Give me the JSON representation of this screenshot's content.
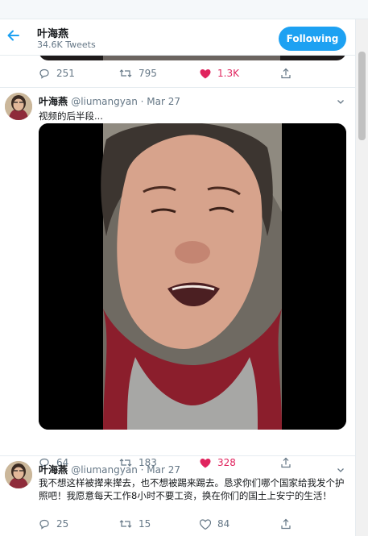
{
  "header": {
    "name": "叶海燕",
    "tweet_count": "34.6K Tweets",
    "follow_label": "Following"
  },
  "prev_tweet": {
    "replies": "251",
    "retweets": "795",
    "likes": "1.3K"
  },
  "tweets": [
    {
      "name": "叶海燕",
      "handle_date": "@liumangyan · Mar 27",
      "text": "视频的后半段...",
      "replies": "64",
      "retweets": "183",
      "likes": "328"
    },
    {
      "name": "叶海燕",
      "handle_date": "@liumangyan · Mar 27",
      "text": "我不想这样被撵来撵去，也不想被踢来踢去。恳求你们哪个国家给我发个护照吧！我愿意每天工作8小时不要工资，换在你们的国土上安宁的生活！",
      "replies": "25",
      "retweets": "15",
      "likes": "84"
    }
  ],
  "colors": {
    "accent": "#1da1f2",
    "like": "#e0245e",
    "muted": "#657786"
  },
  "icons": [
    "back-arrow-icon",
    "reply-icon",
    "retweet-icon",
    "heart-icon",
    "share-icon",
    "chevron-down-icon"
  ]
}
